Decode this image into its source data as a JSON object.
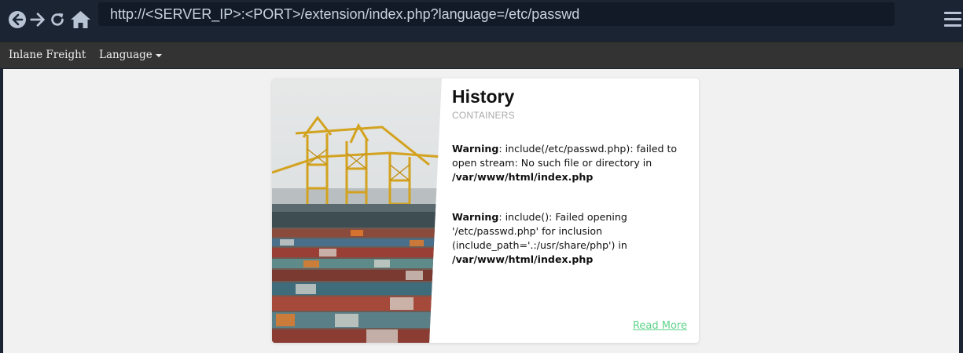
{
  "browser": {
    "url": "http://<SERVER_IP>:<PORT>/extension/index.php?language=/etc/passwd"
  },
  "navbar": {
    "brand": "Inlane Freight",
    "language_label": "Language"
  },
  "card": {
    "title": "History",
    "subtitle": "CONTAINERS",
    "warnings": [
      {
        "label": "Warning",
        "message": ": include(/etc/passwd.php): failed to open stream: No such file or directory in ",
        "path": "/var/www/html/index.php"
      },
      {
        "label": "Warning",
        "message": ": include(): Failed opening '/etc/passwd.php' for inclusion (include_path='.:/usr/share/php') in ",
        "path": "/var/www/html/index.php"
      }
    ],
    "read_more": "Read More",
    "image": "container-port-cranes-photo"
  },
  "colors": {
    "chrome_bg": "#1b2433",
    "navbar_bg": "#333333",
    "page_bg": "#f1f1f1",
    "link": "#5fd38a"
  }
}
